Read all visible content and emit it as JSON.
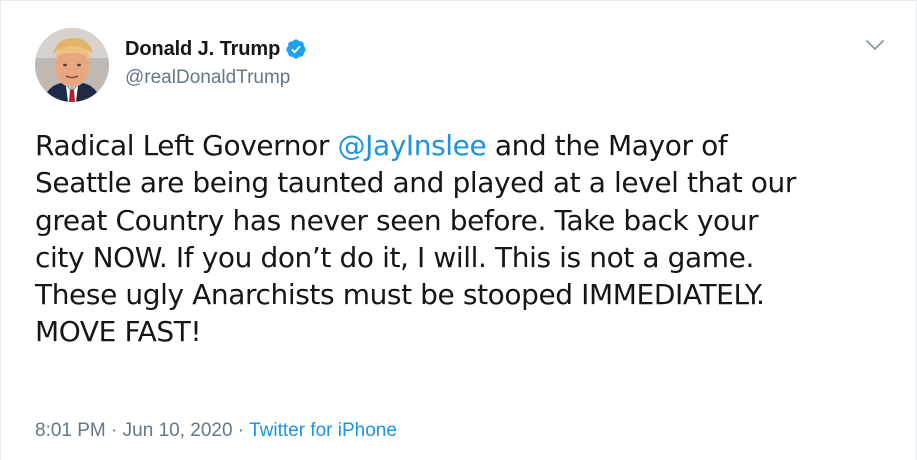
{
  "author": {
    "display_name": "Donald J. Trump",
    "handle": "@realDonaldTrump",
    "verified": true,
    "avatar_icon": "profile-photo"
  },
  "menu": {
    "icon": "chevron-down-icon"
  },
  "tweet": {
    "lines": [
      {
        "before": "Radical Left Governor ",
        "mention": "@JayInslee",
        "after": " and the Mayor of"
      },
      {
        "text": "Seattle are being taunted and played at a level that our"
      },
      {
        "text": "great Country has never seen before. Take back your"
      },
      {
        "text": "city NOW. If you don’t do it, I will. This is not a game."
      },
      {
        "text": "These ugly Anarchists must be stooped IMMEDIATELY."
      },
      {
        "text": "MOVE FAST!"
      }
    ]
  },
  "meta": {
    "time": "8:01 PM",
    "separator": " · ",
    "date": "Jun 10, 2020",
    "source": "Twitter for iPhone"
  },
  "colors": {
    "link": "#1b95e0",
    "secondary_text": "#657786",
    "verified_badge": "#1da1f2"
  }
}
